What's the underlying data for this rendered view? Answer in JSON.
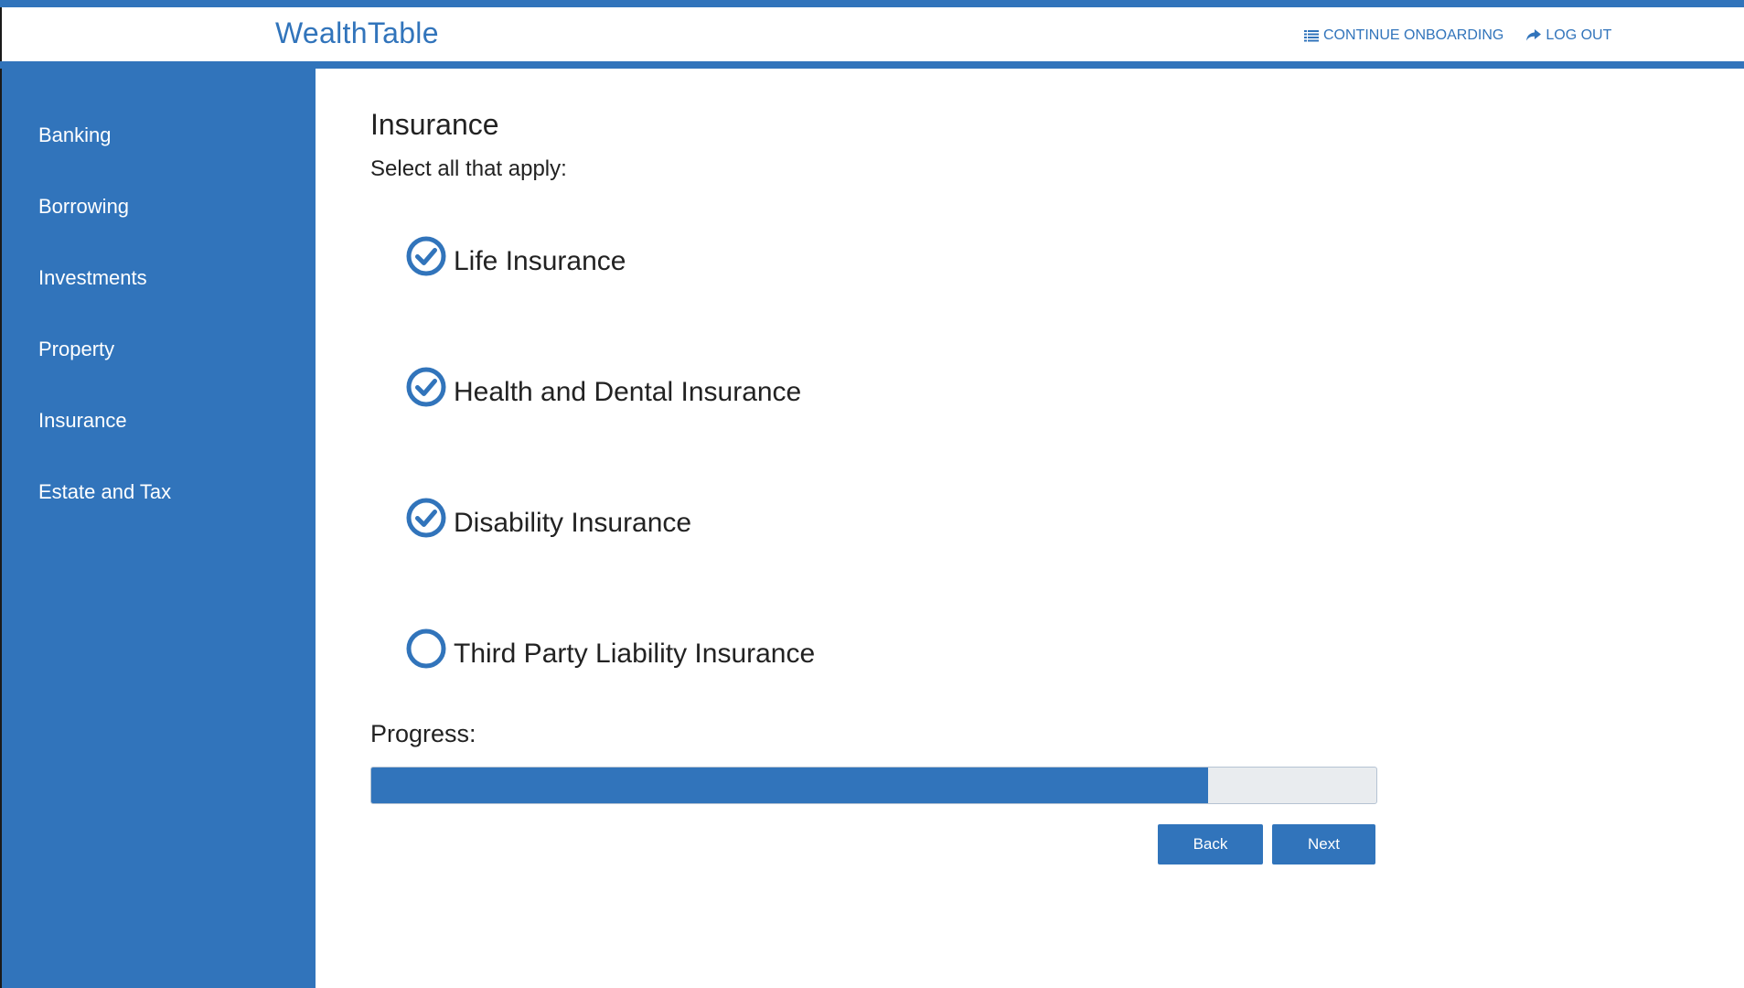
{
  "app": {
    "brand": "WealthTable",
    "accent_color": "#3174bb"
  },
  "header": {
    "continue_label": "CONTINUE ONBOARDING",
    "continue_icon": "list-icon",
    "logout_label": "LOG OUT",
    "logout_icon": "share-arrow-icon"
  },
  "sidebar": {
    "items": [
      {
        "label": "Banking"
      },
      {
        "label": "Borrowing"
      },
      {
        "label": "Investments"
      },
      {
        "label": "Property"
      },
      {
        "label": "Insurance"
      },
      {
        "label": "Estate and Tax"
      }
    ]
  },
  "main": {
    "title": "Insurance",
    "subtitle": "Select all that apply:",
    "options": [
      {
        "label": "Life Insurance",
        "checked": true
      },
      {
        "label": "Health and Dental Insurance",
        "checked": true
      },
      {
        "label": "Disability Insurance",
        "checked": true
      },
      {
        "label": "Third Party Liability Insurance",
        "checked": false
      }
    ],
    "progress_label": "Progress:",
    "progress_fraction": 0.833,
    "back_label": "Back",
    "next_label": "Next"
  }
}
